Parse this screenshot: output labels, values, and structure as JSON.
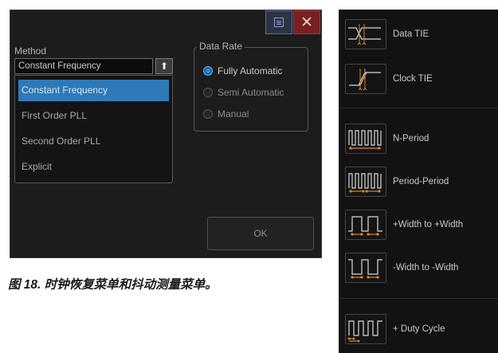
{
  "dialog": {
    "method": {
      "label": "Method",
      "selected_value": "Constant Frequency",
      "options": [
        "Constant Frequency",
        "First Order PLL",
        "Second Order PLL",
        "Explicit"
      ]
    },
    "data_rate": {
      "title": "Data Rate",
      "options": [
        "Fully Automatic",
        "Semi Automatic",
        "Manual"
      ],
      "selected_index": 0
    },
    "ok_label": "OK",
    "close_glyph": "✕"
  },
  "caption": "图 18. 时钟恢复菜单和抖动测量菜单。",
  "measurements": [
    {
      "label": "Data TIE",
      "icon": "data-tie-icon"
    },
    {
      "label": "Clock TIE",
      "icon": "clock-tie-icon"
    },
    {
      "label": "N-Period",
      "icon": "n-period-icon"
    },
    {
      "label": "Period-Period",
      "icon": "period-period-icon"
    },
    {
      "label": "+Width to +Width",
      "icon": "pos-width-icon"
    },
    {
      "label": "-Width to -Width",
      "icon": "neg-width-icon"
    },
    {
      "label": "+ Duty Cycle",
      "icon": "duty-cycle-icon"
    }
  ],
  "colors": {
    "accent_blue": "#2e7ab8",
    "close_red": "#7a1f20",
    "icon_orange": "#e08a1e"
  }
}
